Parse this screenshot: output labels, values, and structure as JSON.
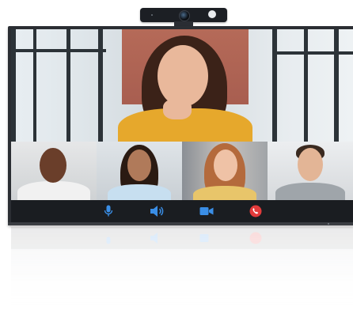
{
  "colors": {
    "mic": "#3a8ee6",
    "speaker": "#3a8ee6",
    "camera": "#3a8ee6",
    "hangup": "#e23b3b",
    "bar": "#1a1d21",
    "frame": "#2b2e33"
  },
  "controls": [
    {
      "name": "mic",
      "icon": "microphone-icon"
    },
    {
      "name": "speaker",
      "icon": "speaker-icon"
    },
    {
      "name": "camera",
      "icon": "video-camera-icon"
    },
    {
      "name": "hangup",
      "icon": "phone-hangup-icon"
    }
  ],
  "participants": [
    {
      "role": "main-speaker"
    },
    {
      "role": "participant-1"
    },
    {
      "role": "participant-2"
    },
    {
      "role": "participant-3"
    },
    {
      "role": "participant-4"
    }
  ]
}
